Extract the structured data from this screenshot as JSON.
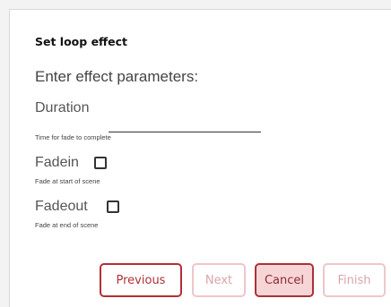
{
  "dialog": {
    "title": "Set loop effect",
    "subtitle": "Enter effect parameters:"
  },
  "fields": {
    "duration": {
      "label": "Duration",
      "help": "Time for fade to complete",
      "value": ""
    },
    "fadein": {
      "label": "Fadein",
      "help": "Fade at start of scene",
      "checked": false
    },
    "fadeout": {
      "label": "Fadeout",
      "help": "Fade at end of scene",
      "checked": false
    }
  },
  "buttons": {
    "previous": "Previous",
    "next": "Next",
    "cancel": "Cancel",
    "finish": "Finish"
  },
  "colors": {
    "accent": "#b03036",
    "disabled": "#d9a5a8",
    "cancel_bg": "#f7d5d7"
  }
}
